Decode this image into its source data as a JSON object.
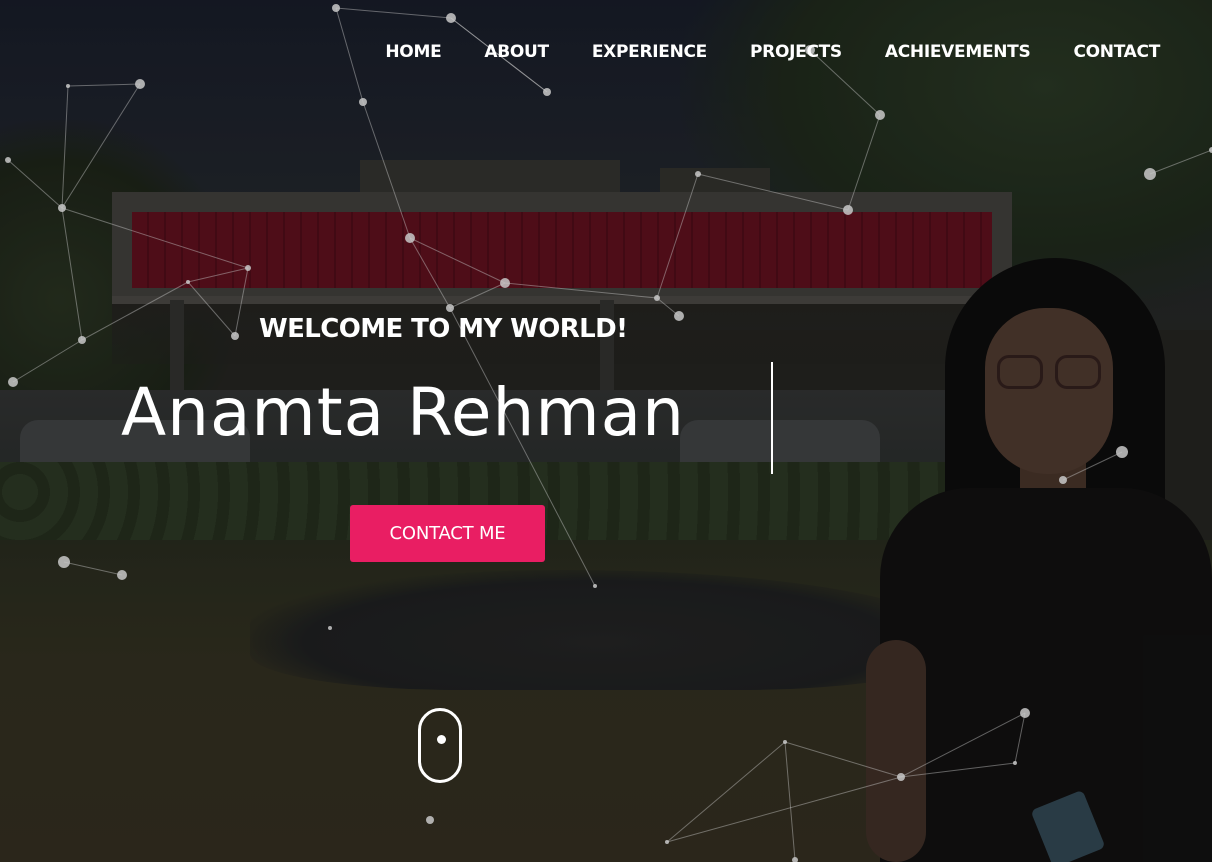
{
  "nav": {
    "items": [
      {
        "label": "HOME"
      },
      {
        "label": "ABOUT"
      },
      {
        "label": "EXPERIENCE"
      },
      {
        "label": "PROJECTS"
      },
      {
        "label": "ACHIEVEMENTS"
      },
      {
        "label": "CONTACT"
      }
    ]
  },
  "hero": {
    "welcome": "WELCOME TO MY WORLD!",
    "name": "Anamta Rehman",
    "cta_label": "CONTACT ME"
  },
  "colors": {
    "accent": "#e91e63",
    "text": "#ffffff",
    "particles": "#c8c8c8"
  },
  "icons": {
    "scroll_indicator": "mouse-scroll-icon"
  }
}
